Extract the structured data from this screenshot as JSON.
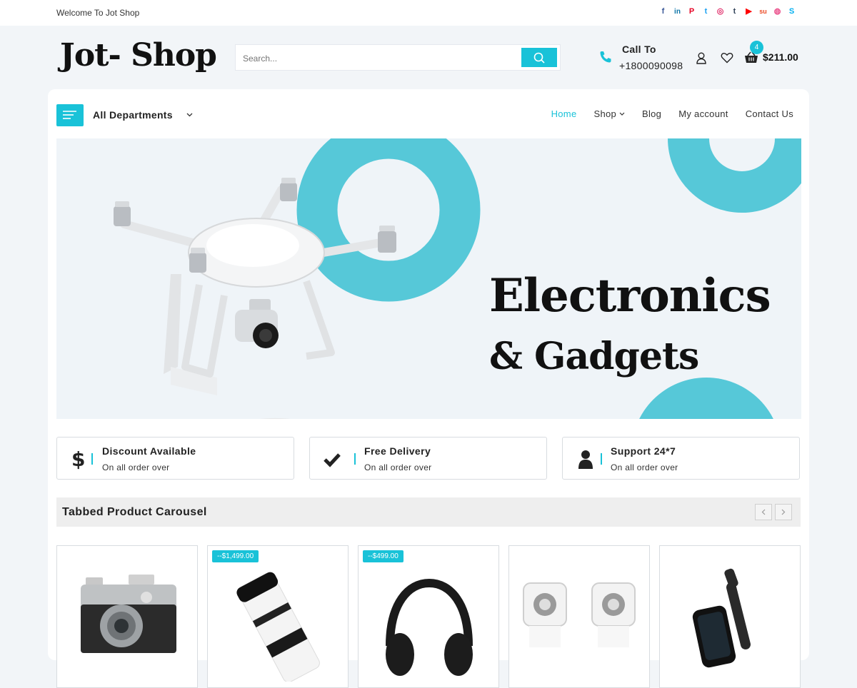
{
  "topbar": {
    "welcome": "Welcome To Jot Shop"
  },
  "social": [
    {
      "name": "facebook",
      "glyph": "f",
      "color": "#3b5998"
    },
    {
      "name": "linkedin",
      "glyph": "in",
      "color": "#0e76a8"
    },
    {
      "name": "pinterest",
      "glyph": "P",
      "color": "#e60023"
    },
    {
      "name": "twitter",
      "glyph": "t",
      "color": "#1da1f2"
    },
    {
      "name": "instagram",
      "glyph": "◎",
      "color": "#e1306c"
    },
    {
      "name": "tumblr",
      "glyph": "t",
      "color": "#35465c"
    },
    {
      "name": "youtube",
      "glyph": "▶",
      "color": "#ff0000"
    },
    {
      "name": "stumbleupon",
      "glyph": "su",
      "color": "#eb4924"
    },
    {
      "name": "dribbble",
      "glyph": "◍",
      "color": "#ea4c89"
    },
    {
      "name": "skype",
      "glyph": "S",
      "color": "#00aff0"
    }
  ],
  "brand": {
    "name": "Jot- Shop"
  },
  "search": {
    "placeholder": "Search..."
  },
  "contact": {
    "title": "Call To",
    "number": "+1800090098"
  },
  "cart": {
    "count": "4",
    "total": "$211.00"
  },
  "nav": {
    "departments": "All Departments",
    "items": [
      "Home",
      "Shop",
      "Blog",
      "My account",
      "Contact Us"
    ]
  },
  "banner": {
    "line1": "Electronics",
    "line2": "& Gadgets"
  },
  "features": [
    {
      "title": "Discount Available",
      "sub": "On all order over",
      "icon": "dollar-icon"
    },
    {
      "title": "Free Delivery",
      "sub": "On all order over",
      "icon": "check-icon"
    },
    {
      "title": "Support 24*7",
      "sub": "On all order over",
      "icon": "user-support-icon"
    }
  ],
  "carousel": {
    "title": "Tabbed Product Carousel",
    "products": [
      {
        "name": "camera",
        "tag": ""
      },
      {
        "name": "lens",
        "tag": "--$1,499.00"
      },
      {
        "name": "headphones",
        "tag": "--$499.00"
      },
      {
        "name": "speakers",
        "tag": ""
      },
      {
        "name": "smartwatch",
        "tag": ""
      }
    ]
  },
  "colors": {
    "accent": "#19c2d8",
    "bg": "#f2f5f8"
  }
}
